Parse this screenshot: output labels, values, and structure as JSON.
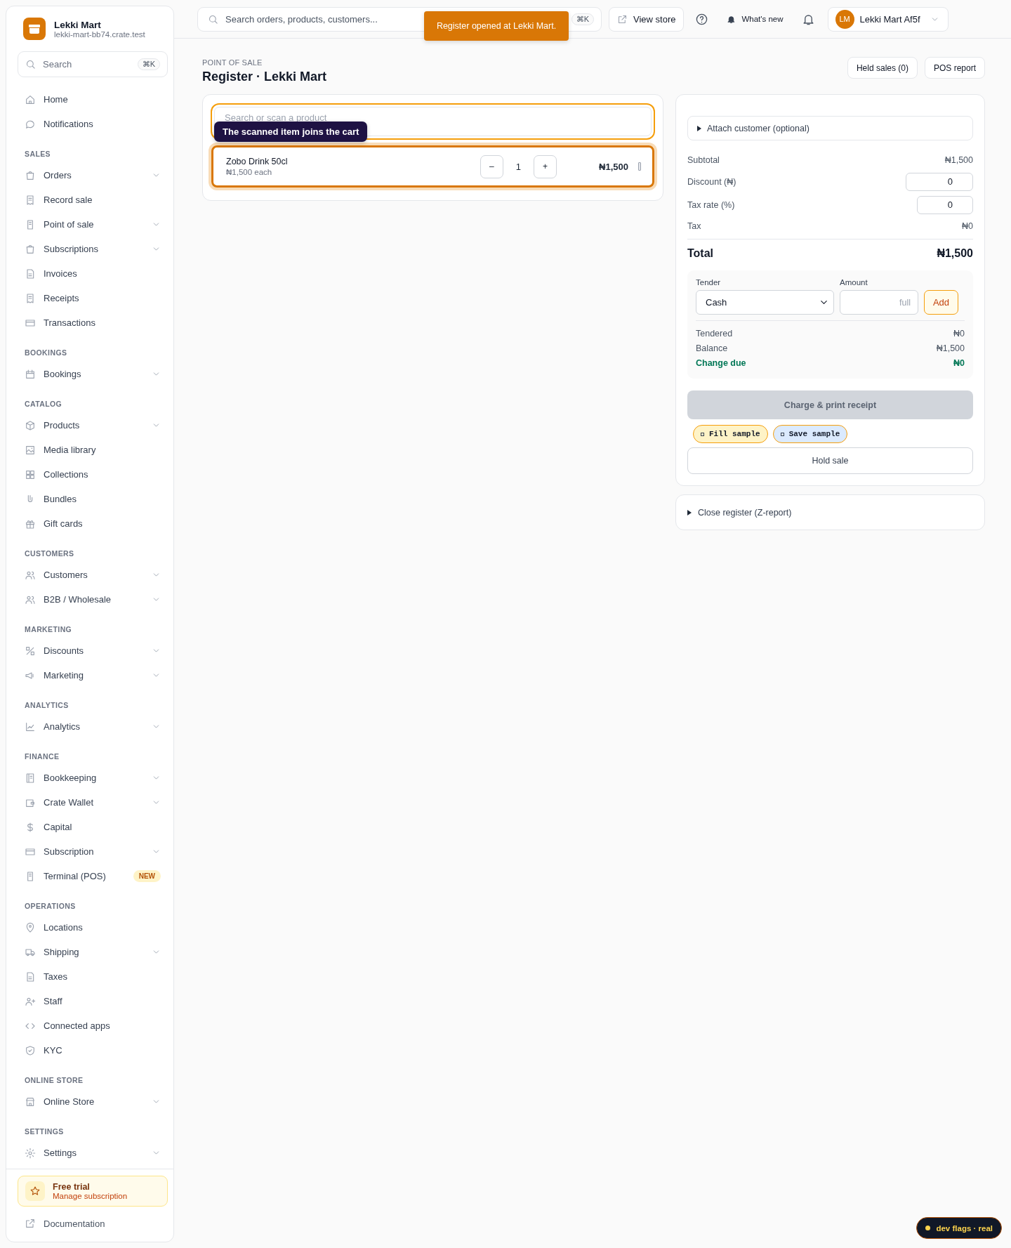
{
  "sidebar": {
    "store": {
      "name": "Lekki Mart",
      "domain": "lekki-mart-bb74.crate.test"
    },
    "search": {
      "placeholder": "Search",
      "shortcut": "⌘K"
    },
    "sections": [
      {
        "items": [
          {
            "label": "Home",
            "expandable": false
          },
          {
            "label": "Notifications",
            "expandable": false
          }
        ]
      },
      {
        "heading": "SALES",
        "items": [
          {
            "label": "Orders",
            "expandable": true
          },
          {
            "label": "Record sale",
            "expandable": false
          },
          {
            "label": "Point of sale",
            "expandable": true
          },
          {
            "label": "Subscriptions",
            "expandable": true
          },
          {
            "label": "Invoices",
            "expandable": false
          },
          {
            "label": "Receipts",
            "expandable": false
          },
          {
            "label": "Transactions",
            "expandable": false
          }
        ]
      },
      {
        "heading": "BOOKINGS",
        "items": [
          {
            "label": "Bookings",
            "expandable": true
          }
        ]
      },
      {
        "heading": "CATALOG",
        "items": [
          {
            "label": "Products",
            "expandable": true
          },
          {
            "label": "Media library",
            "expandable": false
          },
          {
            "label": "Collections",
            "expandable": false
          },
          {
            "label": "Bundles",
            "expandable": false
          },
          {
            "label": "Gift cards",
            "expandable": false
          }
        ]
      },
      {
        "heading": "CUSTOMERS",
        "items": [
          {
            "label": "Customers",
            "expandable": true
          },
          {
            "label": "B2B / Wholesale",
            "expandable": true
          }
        ]
      },
      {
        "heading": "MARKETING",
        "items": [
          {
            "label": "Discounts",
            "expandable": true
          },
          {
            "label": "Marketing",
            "expandable": true
          }
        ]
      },
      {
        "heading": "ANALYTICS",
        "items": [
          {
            "label": "Analytics",
            "expandable": true
          }
        ]
      },
      {
        "heading": "FINANCE",
        "items": [
          {
            "label": "Bookkeeping",
            "expandable": true
          },
          {
            "label": "Crate Wallet",
            "expandable": true
          },
          {
            "label": "Capital",
            "expandable": false
          },
          {
            "label": "Subscription",
            "expandable": true
          },
          {
            "label": "Terminal (POS)",
            "expandable": false,
            "badge": "NEW"
          }
        ]
      },
      {
        "heading": "OPERATIONS",
        "items": [
          {
            "label": "Locations",
            "expandable": false
          },
          {
            "label": "Shipping",
            "expandable": true
          },
          {
            "label": "Taxes",
            "expandable": false
          },
          {
            "label": "Staff",
            "expandable": false
          },
          {
            "label": "Connected apps",
            "expandable": false
          },
          {
            "label": "KYC",
            "expandable": false
          }
        ]
      },
      {
        "heading": "ONLINE STORE",
        "items": [
          {
            "label": "Online Store",
            "expandable": true
          }
        ]
      },
      {
        "heading": "SETTINGS",
        "items": [
          {
            "label": "Settings",
            "expandable": true
          }
        ]
      }
    ],
    "trial": {
      "title": "Free trial",
      "subtitle": "Manage subscription"
    },
    "documentation": "Documentation"
  },
  "topbar": {
    "search": {
      "placeholder": "Search orders, products, customers...",
      "shortcut": "⌘K"
    },
    "view_store": "View store",
    "whats_new": "What's new",
    "account": {
      "initials": "LM",
      "name": "Lekki Mart Af5f"
    }
  },
  "toast": "Register opened at Lekki Mart.",
  "page": {
    "eyebrow": "POINT OF SALE",
    "title": "Register · Lekki Mart",
    "actions": [
      "Held sales (0)",
      "POS report"
    ]
  },
  "cart": {
    "search": {
      "placeholder": "Search or scan a product",
      "focused": true
    },
    "tooltip": "The scanned item joins the cart",
    "items": [
      {
        "name": "Zobo Drink 50cl",
        "unit_price": "₦1,500 each",
        "decrease": "–",
        "quantity": "1",
        "increase": "+",
        "total": "₦1,500",
        "highlighted": true
      }
    ]
  },
  "summary": {
    "customer": {
      "label": "Attach customer (optional)",
      "expanded": false
    },
    "rows": [
      {
        "kind": "text",
        "label": "Subtotal",
        "value": "₦1,500"
      },
      {
        "kind": "input",
        "label": "Discount (₦)",
        "value": "0"
      },
      {
        "kind": "input",
        "label": "Tax rate (%)",
        "value": "0"
      },
      {
        "kind": "text",
        "label": "Tax",
        "value": "₦0"
      }
    ],
    "total": {
      "label": "Total",
      "value": "₦1,500"
    },
    "tender": {
      "tender_label": "Tender",
      "method": "Cash",
      "amount_label": "Amount",
      "amount_placeholder": "full",
      "add": "Add",
      "rows": [
        {
          "label": "Tendered",
          "value": "₦0",
          "highlight": false
        },
        {
          "label": "Balance",
          "value": "₦1,500",
          "highlight": false
        },
        {
          "label": "Change due",
          "value": "₦0",
          "highlight": true
        }
      ]
    },
    "charge": {
      "label": "Charge & print receipt",
      "disabled": true
    },
    "dev_buttons": [
      {
        "label": "Fill sample",
        "color": "#fef3c7"
      },
      {
        "label": "Save sample",
        "color": "#dbeafe"
      }
    ],
    "hold": "Hold sale"
  },
  "close_register": {
    "label": "Close register (Z-report)",
    "expanded": false
  },
  "dev_flags": "dev flags · real"
}
